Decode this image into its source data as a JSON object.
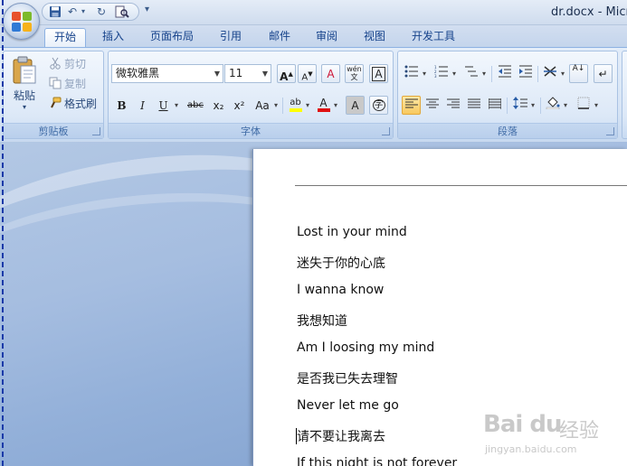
{
  "window": {
    "title": "dr.docx - Micr"
  },
  "quick_access": {
    "save_icon": "save-icon",
    "undo": "↶",
    "redo": "↻",
    "customize": "▾"
  },
  "tabs": [
    {
      "label": "开始",
      "active": true
    },
    {
      "label": "插入"
    },
    {
      "label": "页面布局"
    },
    {
      "label": "引用"
    },
    {
      "label": "邮件"
    },
    {
      "label": "审阅"
    },
    {
      "label": "视图"
    },
    {
      "label": "开发工具"
    }
  ],
  "clipboard": {
    "label": "剪贴板",
    "paste": "粘贴",
    "cut": "剪切",
    "copy": "复制",
    "format_painter": "格式刷"
  },
  "font": {
    "label": "字体",
    "family": "微软雅黑",
    "size": "11",
    "grow": "A",
    "shrink": "A",
    "clear": "A",
    "phonetic": "wén",
    "border_char": "A",
    "bold": "B",
    "italic": "I",
    "underline": "U",
    "strike": "abc",
    "subscript": "x₂",
    "superscript": "x²",
    "change_case": "Aa",
    "highlight": "ab",
    "font_color": "A",
    "char_shading": "A",
    "enclose": "字"
  },
  "paragraph": {
    "label": "段落",
    "sort": "A↓",
    "marks": "↵"
  },
  "colors": {
    "highlight": "#ffff00",
    "font_color": "#e01010",
    "accent": "#15428b"
  },
  "document": {
    "lines": [
      "Lost in your mind",
      "迷失于你的心底",
      "I wanna know",
      "我想知道",
      "Am I loosing my mind",
      "是否我已失去理智",
      "Never let me go",
      "请不要让我离去",
      "If this night is not forever"
    ]
  },
  "watermark": {
    "brand": "Bai du",
    "cn": "经验",
    "url": "jingyan.baidu.com"
  }
}
